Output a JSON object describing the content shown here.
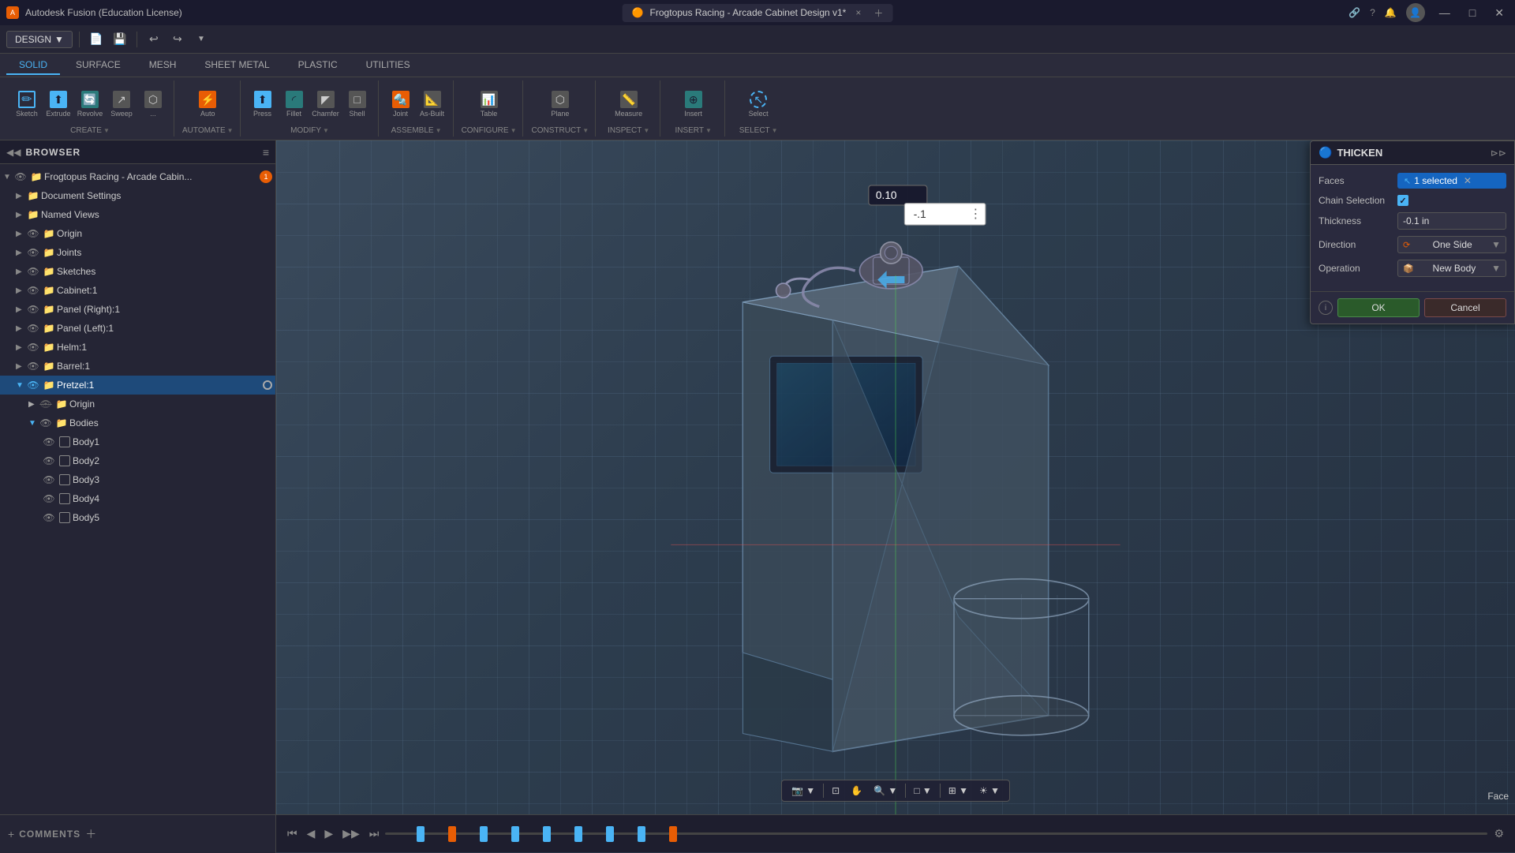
{
  "app": {
    "title": "Autodesk Fusion (Education License)",
    "document_title": "Frogtopus Racing - Arcade Cabinet Design v1*",
    "close_tab": "×"
  },
  "design_mode": {
    "label": "DESIGN",
    "arrow": "▼"
  },
  "tabs": [
    {
      "id": "solid",
      "label": "SOLID",
      "active": true
    },
    {
      "id": "surface",
      "label": "SURFACE"
    },
    {
      "id": "mesh",
      "label": "MESH"
    },
    {
      "id": "sheet-metal",
      "label": "SHEET METAL"
    },
    {
      "id": "plastic",
      "label": "PLASTIC"
    },
    {
      "id": "utilities",
      "label": "UTILITIES"
    }
  ],
  "ribbon": {
    "create": {
      "label": "CREATE",
      "icons": [
        "new-body",
        "extrude",
        "revolve",
        "sweep",
        "loft",
        "rib"
      ]
    },
    "automate": {
      "label": "AUTOMATE"
    },
    "modify": {
      "label": "MODIFY"
    },
    "assemble": {
      "label": "ASSEMBLE"
    },
    "configure": {
      "label": "CONFIGURE"
    },
    "construct": {
      "label": "CONSTRUCT"
    },
    "inspect": {
      "label": "INSPECT"
    },
    "insert": {
      "label": "INSERT"
    },
    "select": {
      "label": "SELECT"
    }
  },
  "browser": {
    "title": "BROWSER",
    "items": [
      {
        "id": "root",
        "label": "Frogtopus Racing - Arcade Cabin...",
        "depth": 0,
        "expanded": true,
        "has_eye": true,
        "has_folder": true,
        "badge": "1"
      },
      {
        "id": "doc-settings",
        "label": "Document Settings",
        "depth": 1,
        "expanded": false,
        "has_eye": false,
        "has_folder": true
      },
      {
        "id": "named-views",
        "label": "Named Views",
        "depth": 1,
        "expanded": false,
        "has_eye": false,
        "has_folder": true
      },
      {
        "id": "origin",
        "label": "Origin",
        "depth": 1,
        "expanded": false,
        "has_eye": true,
        "has_folder": true
      },
      {
        "id": "joints",
        "label": "Joints",
        "depth": 1,
        "expanded": false,
        "has_eye": true,
        "has_folder": true
      },
      {
        "id": "sketches",
        "label": "Sketches",
        "depth": 1,
        "expanded": false,
        "has_eye": true,
        "has_folder": true
      },
      {
        "id": "cabinet",
        "label": "Cabinet:1",
        "depth": 1,
        "expanded": false,
        "has_eye": true,
        "has_folder": true
      },
      {
        "id": "panel-right",
        "label": "Panel (Right):1",
        "depth": 1,
        "expanded": false,
        "has_eye": true,
        "has_folder": true
      },
      {
        "id": "panel-left",
        "label": "Panel (Left):1",
        "depth": 1,
        "expanded": false,
        "has_eye": true,
        "has_folder": true
      },
      {
        "id": "helm",
        "label": "Helm:1",
        "depth": 1,
        "expanded": false,
        "has_eye": true,
        "has_folder": true
      },
      {
        "id": "barrel",
        "label": "Barrel:1",
        "depth": 1,
        "expanded": false,
        "has_eye": true,
        "has_folder": true
      },
      {
        "id": "pretzel",
        "label": "Pretzel:1",
        "depth": 1,
        "expanded": true,
        "has_eye": true,
        "has_folder": true,
        "active": true,
        "has_circle": true
      },
      {
        "id": "origin2",
        "label": "Origin",
        "depth": 2,
        "expanded": false,
        "has_eye": true,
        "has_folder": true
      },
      {
        "id": "bodies",
        "label": "Bodies",
        "depth": 2,
        "expanded": true,
        "has_eye": true,
        "has_folder": true
      },
      {
        "id": "body1",
        "label": "Body1",
        "depth": 3,
        "has_eye": true,
        "has_checkbox": true
      },
      {
        "id": "body2",
        "label": "Body2",
        "depth": 3,
        "has_eye": true,
        "has_checkbox": true
      },
      {
        "id": "body3",
        "label": "Body3",
        "depth": 3,
        "has_eye": true,
        "has_checkbox": true
      },
      {
        "id": "body4",
        "label": "Body4",
        "depth": 3,
        "has_eye": true,
        "has_checkbox": true
      },
      {
        "id": "body5",
        "label": "Body5",
        "depth": 3,
        "has_eye": true,
        "has_checkbox": true
      }
    ]
  },
  "thicken": {
    "title": "THICKEN",
    "params": {
      "faces_label": "Faces",
      "faces_value": "1 selected",
      "chain_label": "Chain Selection",
      "thickness_label": "Thickness",
      "thickness_value": "-0.1 in",
      "direction_label": "Direction",
      "direction_value": "One Side",
      "operation_label": "Operation",
      "operation_value": "New Body"
    },
    "ok_label": "OK",
    "cancel_label": "Cancel"
  },
  "viewport": {
    "dimension_value": "0.10",
    "input_value": "-.1",
    "face_label": "Face"
  },
  "comments": {
    "label": "COMMENTS"
  },
  "timeline": {
    "play_first": "⏮",
    "play_back": "◀",
    "play": "▶",
    "play_fwd": "▶▶",
    "play_last": "⏭"
  },
  "statusbar": {
    "settings_icon": "⚙"
  }
}
